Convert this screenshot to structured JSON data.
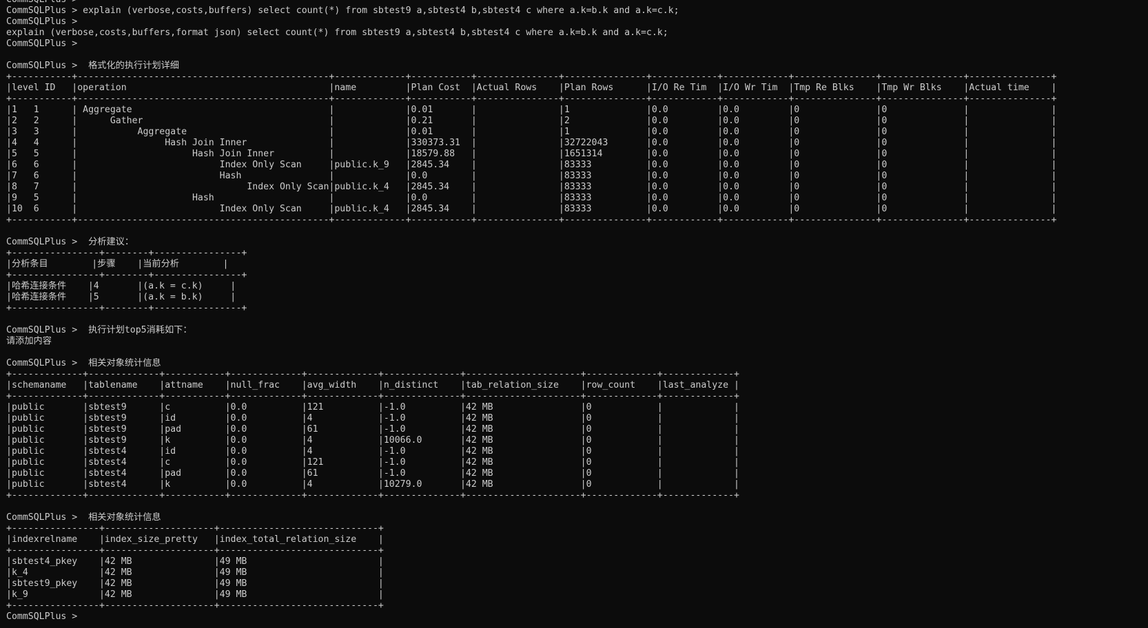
{
  "terminal": {
    "prompt": "CommSQLPlus >",
    "lines": [
      "CommSQLPlus >",
      "CommSQLPlus > explain (verbose,costs,buffers) select count(*) from sbtest9 a,sbtest4 b,sbtest4 c where a.k=b.k and a.k=c.k;",
      "CommSQLPlus >",
      "explain (verbose,costs,buffers,format json) select count(*) from sbtest9 a,sbtest4 b,sbtest4 c where a.k=b.k and a.k=c.k;",
      "CommSQLPlus >",
      "",
      "CommSQLPlus >  格式化的执行计划详细",
      "+-----------+----------------------------------------------+-------------+-----------+---------------+---------------+------------+------------+---------------+---------------+---------------+",
      "|level ID   |operation                                     |name         |Plan Cost  |Actual Rows    |Plan Rows      |I/O Re Tim  |I/O Wr Tim  |Tmp Re Blks    |Tmp Wr Blks    |Actual time    |",
      "+-----------+----------------------------------------------+-------------+-----------+---------------+---------------+------------+------------+---------------+---------------+---------------+",
      "|1   1      | Aggregate                                    |             |0.01       |               |1              |0.0         |0.0         |0              |0              |               |",
      "|2   2      |      Gather                                  |             |0.21       |               |2              |0.0         |0.0         |0              |0              |               |",
      "|3   3      |           Aggregate                          |             |0.01       |               |1              |0.0         |0.0         |0              |0              |               |",
      "|4   4      |                Hash Join Inner               |             |330373.31  |               |32722043       |0.0         |0.0         |0              |0              |               |",
      "|5   5      |                     Hash Join Inner          |             |18579.88   |               |1651314        |0.0         |0.0         |0              |0              |               |",
      "|6   6      |                          Index Only Scan     |public.k_9   |2845.34    |               |83333          |0.0         |0.0         |0              |0              |               |",
      "|7   6      |                          Hash                |             |0.0        |               |83333          |0.0         |0.0         |0              |0              |               |",
      "|8   7      |                               Index Only Scan|public.k_4   |2845.34    |               |83333          |0.0         |0.0         |0              |0              |               |",
      "|9   5      |                     Hash                     |             |0.0        |               |83333          |0.0         |0.0         |0              |0              |               |",
      "|10  6      |                          Index Only Scan     |public.k_4   |2845.34    |               |83333          |0.0         |0.0         |0              |0              |               |",
      "+-----------+----------------------------------------------+-------------+-----------+---------------+---------------+------------+------------+---------------+---------------+---------------+",
      "",
      "CommSQLPlus >  分析建议：",
      "+----------------+--------+----------------+",
      "|分析条目        |步骤    |当前分析        |",
      "+----------------+--------+----------------+",
      "|哈希连接条件    |4       |(a.k = c.k)     |",
      "|哈希连接条件    |5       |(a.k = b.k)     |",
      "+----------------+--------+----------------+",
      "",
      "CommSQLPlus >  执行计划top5消耗如下：",
      "请添加内容",
      "",
      "CommSQLPlus >  相关对象统计信息",
      "+-------------+-------------+-----------+-------------+-------------+--------------+---------------------+-------------+-------------+",
      "|schemaname   |tablename    |attname    |null_frac    |avg_width    |n_distinct    |tab_relation_size    |row_count    |last_analyze |",
      "+-------------+-------------+-----------+-------------+-------------+--------------+---------------------+-------------+-------------+",
      "|public       |sbtest9      |c          |0.0          |121          |-1.0          |42 MB                |0            |             |",
      "|public       |sbtest9      |id         |0.0          |4            |-1.0          |42 MB                |0            |             |",
      "|public       |sbtest9      |pad        |0.0          |61           |-1.0          |42 MB                |0            |             |",
      "|public       |sbtest9      |k          |0.0          |4            |10066.0       |42 MB                |0            |             |",
      "|public       |sbtest4      |id         |0.0          |4            |-1.0          |42 MB                |0            |             |",
      "|public       |sbtest4      |c          |0.0          |121          |-1.0          |42 MB                |0            |             |",
      "|public       |sbtest4      |pad        |0.0          |61           |-1.0          |42 MB                |0            |             |",
      "|public       |sbtest4      |k          |0.0          |4            |10279.0       |42 MB                |0            |             |",
      "+-------------+-------------+-----------+-------------+-------------+--------------+---------------------+-------------+-------------+",
      "",
      "CommSQLPlus >  相关对象统计信息",
      "+----------------+--------------------+-----------------------------+",
      "|indexrelname    |index_size_pretty   |index_total_relation_size    |",
      "+----------------+--------------------+-----------------------------+",
      "|sbtest4_pkey    |42 MB               |49 MB                        |",
      "|k_4             |42 MB               |49 MB                        |",
      "|sbtest9_pkey    |42 MB               |49 MB                        |",
      "|k_9             |42 MB               |49 MB                        |",
      "+----------------+--------------------+-----------------------------+",
      "CommSQLPlus >"
    ]
  }
}
